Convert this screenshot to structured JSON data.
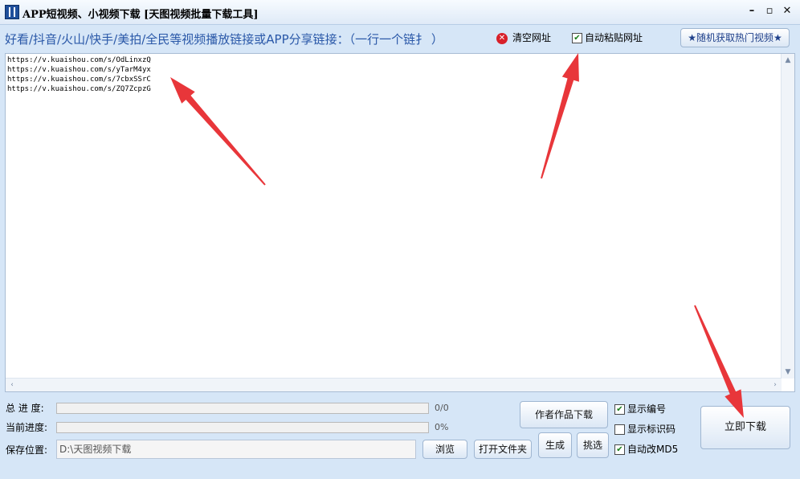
{
  "window": {
    "title": "APP短视频、小视频下载 [天图视频批量下载工具]",
    "minimize": "–",
    "maximize": "▫",
    "close": "✕"
  },
  "header": {
    "hint": "好看/抖音/火山/快手/美拍/全民等视频播放链接或APP分享链接：（一行一个链扌 ）",
    "clear_label": "清空网址",
    "auto_paste_label": "自动粘贴网址",
    "hot_videos_label": "★随机获取热门视频★"
  },
  "urls": [
    "https://v.kuaishou.com/s/OdLinxzQ",
    "https://v.kuaishou.com/s/yTarM4yx",
    "https://v.kuaishou.com/s/7cbxSSrC",
    "https://v.kuaishou.com/s/ZQ7ZcpzG"
  ],
  "progress": {
    "total_label": "总 进 度:",
    "total_text": "0/0",
    "total_value": 0,
    "current_label": "当前进度:",
    "current_text": "0%",
    "current_value": 0
  },
  "save": {
    "label": "保存位置:",
    "path": "D:\\天图视频下载",
    "browse_label": "浏览",
    "open_folder_label": "打开文件夹"
  },
  "actions": {
    "author_download_label": "作者作品下载",
    "generate_label": "生成",
    "pick_label": "挑选",
    "download_now_label": "立即下载"
  },
  "options": {
    "show_number_label": "显示编号",
    "show_number_checked": true,
    "show_mark_label": "显示标识码",
    "show_mark_checked": false,
    "auto_md5_label": "自动改MD5",
    "auto_md5_checked": true
  },
  "colors": {
    "hint_text": "#2a58a8",
    "arrow": "#e8363a",
    "window_bg": "#d6e6f7"
  }
}
